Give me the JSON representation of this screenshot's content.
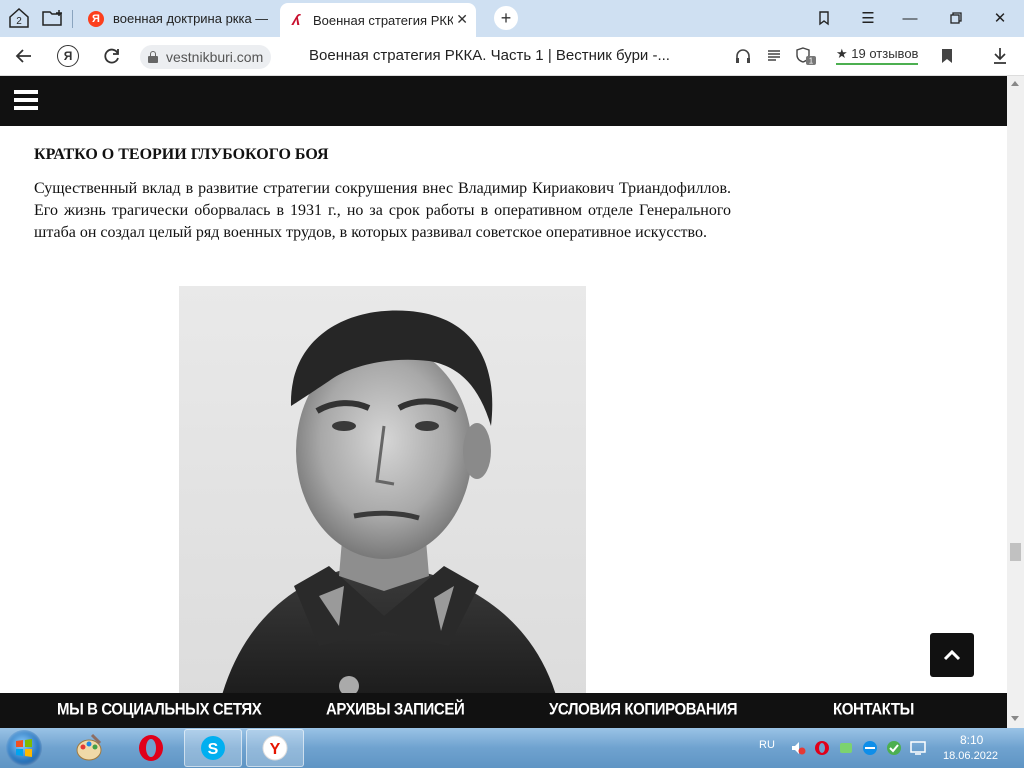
{
  "tabstrip": {
    "tab_count_badge": "2",
    "tabs": [
      {
        "title": "военная доктрина ркка —",
        "active": false
      },
      {
        "title": "Военная стратегия РККА.",
        "active": true
      }
    ]
  },
  "navbar": {
    "ya_label": "Я",
    "domain": "vestnikburi.com",
    "page_title": "Военная стратегия РККА. Часть 1 | Вестник бури -...",
    "reviews_label": "19 отзывов",
    "notification_count": "1"
  },
  "article": {
    "heading": "КРАТКО О ТЕОРИИ ГЛУБОКОГО БОЯ",
    "paragraph": "Существенный вклад в развитие стратегии сокрушения внес Владимир Кириакович Триандофиллов. Его жизнь трагически оборвалась в 1931 г., но за срок работы в оперативном отделе Генерального штаба он создал целый ряд военных трудов, в которых развивал советское оперативное искусство."
  },
  "footer": {
    "links": [
      "МЫ В СОЦИАЛЬНЫХ СЕТЯХ",
      "АРХИВЫ ЗАПИСЕЙ",
      "УСЛОВИЯ КОПИРОВАНИЯ",
      "КОНТАКТЫ"
    ]
  },
  "taskbar": {
    "language": "RU",
    "time": "8:10",
    "date": "18.06.2022"
  },
  "colors": {
    "tabstrip": "#cfe0f2",
    "site_header": "#111111",
    "accent_green": "#4caf50",
    "yandex_red": "#fc3f1d"
  }
}
